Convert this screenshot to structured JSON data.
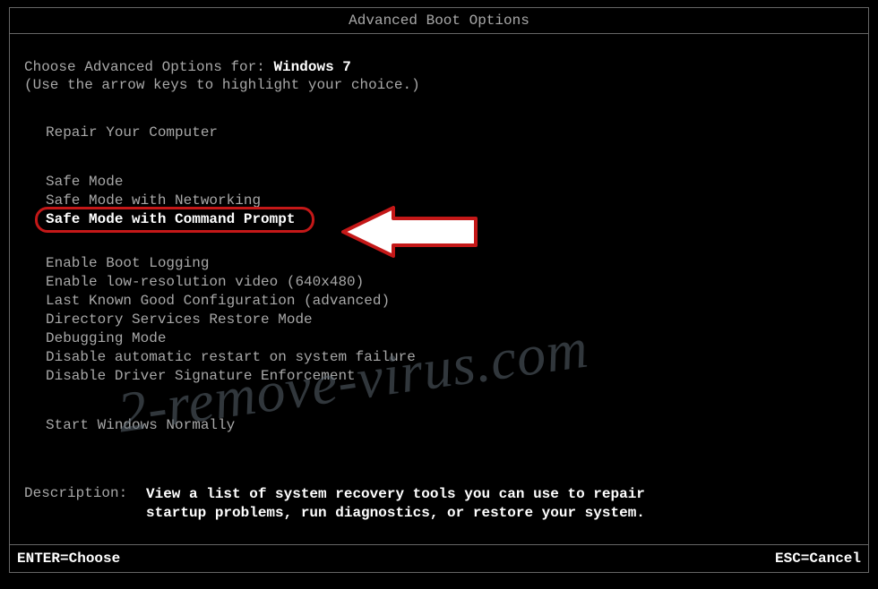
{
  "title": "Advanced Boot Options",
  "choose_prefix": "Choose Advanced Options for: ",
  "os_name": "Windows 7",
  "hint": "(Use the arrow keys to highlight your choice.)",
  "groups": {
    "repair": {
      "item": "Repair Your Computer"
    },
    "safe": {
      "item0": "Safe Mode",
      "item1": "Safe Mode with Networking",
      "item2": "Safe Mode with Command Prompt"
    },
    "advanced": {
      "item0": "Enable Boot Logging",
      "item1": "Enable low-resolution video (640x480)",
      "item2": "Last Known Good Configuration (advanced)",
      "item3": "Directory Services Restore Mode",
      "item4": "Debugging Mode",
      "item5": "Disable automatic restart on system failure",
      "item6": "Disable Driver Signature Enforcement"
    },
    "normal": {
      "item": "Start Windows Normally"
    }
  },
  "description": {
    "label": "Description:",
    "text": "View a list of system recovery tools you can use to repair startup problems, run diagnostics, or restore your system."
  },
  "footer": {
    "enter": "ENTER=Choose",
    "esc": "ESC=Cancel"
  },
  "watermark": "2-remove-virus.com",
  "annotation": {
    "arrow_target": "Safe Mode with Command Prompt"
  }
}
